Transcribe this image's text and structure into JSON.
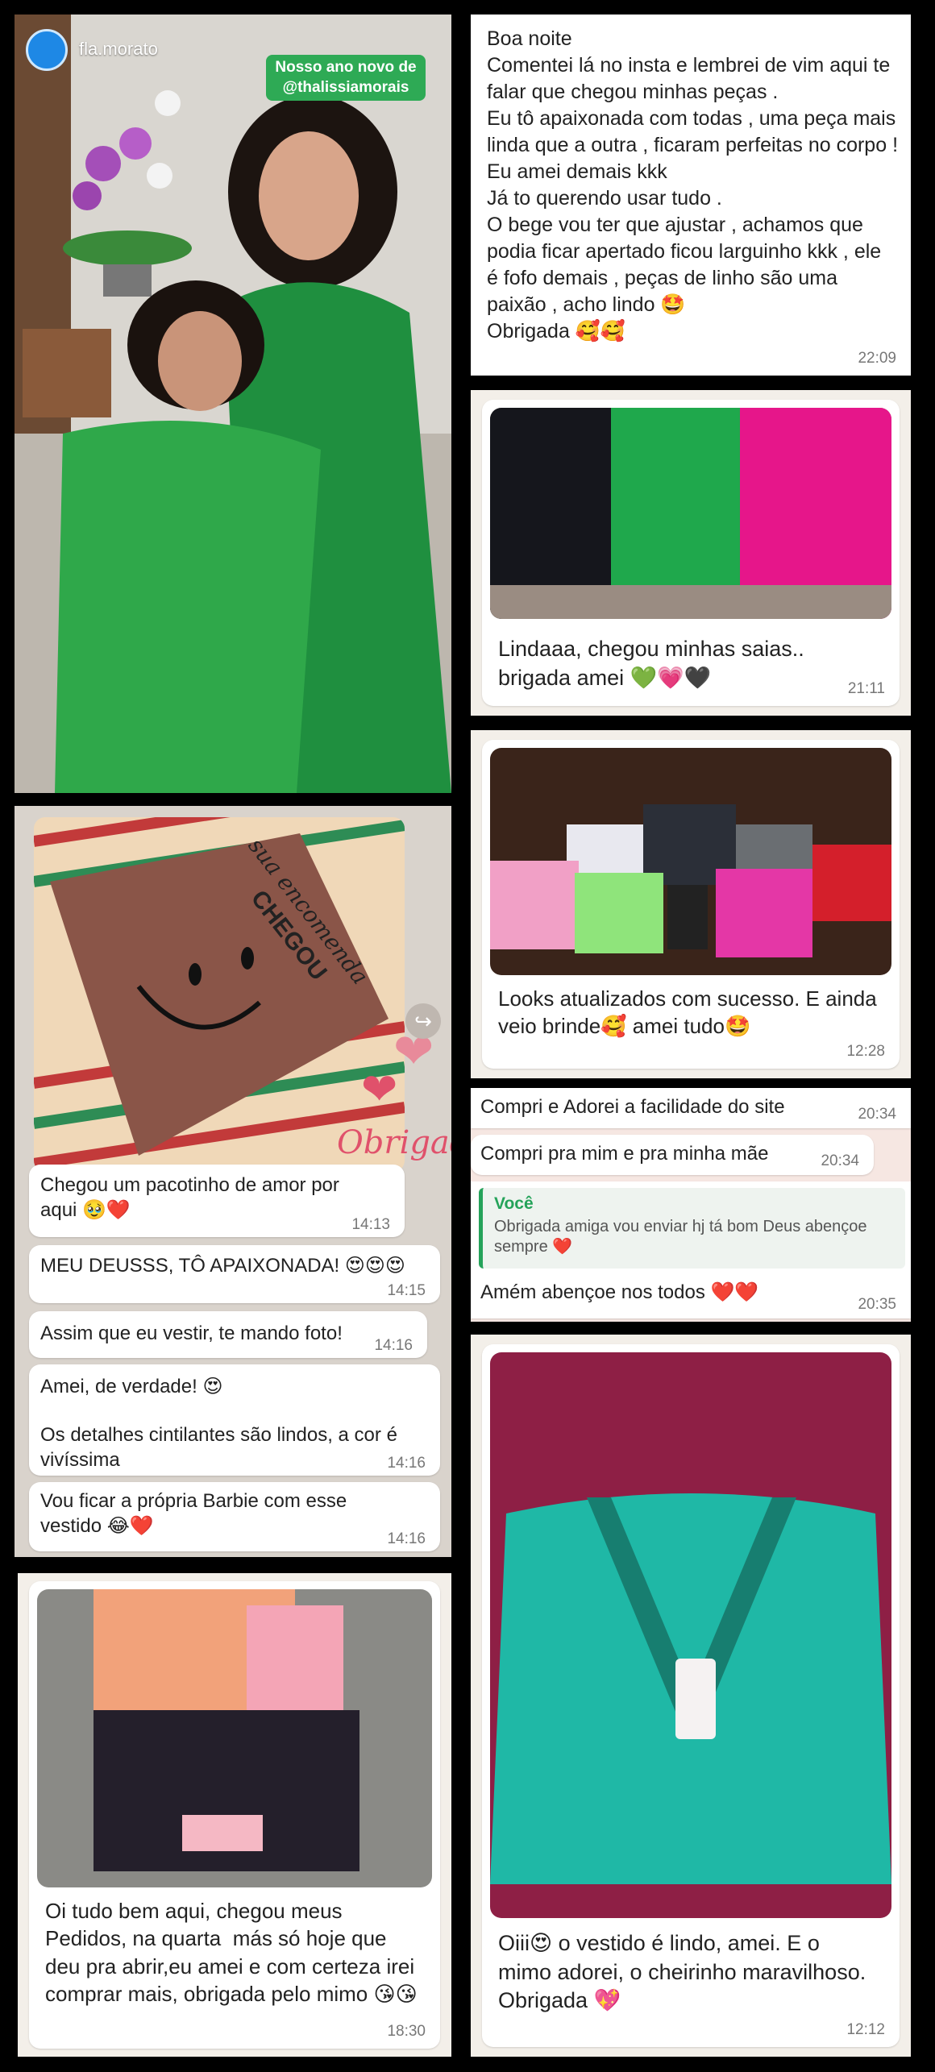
{
  "story": {
    "username": "fla.morato",
    "tag_line1": "Nosso ano novo de",
    "tag_line2": "@thalissiamorais"
  },
  "chat1": {
    "text": "Boa noite\nComentei lá no insta e lembrei de vim aqui te falar que chegou minhas peças .\nEu tô apaixonada com todas , uma peça mais linda que a outra , ficaram perfeitas no corpo !\nEu amei demais kkk\nJá to querendo usar tudo .\nO bege vou ter que ajustar , achamos que podia ficar apertado ficou larguinho kkk , ele é fofo demais , peças de linho são uma paixão , acho lindo 🤩\nObrigada 🥰🥰",
    "time": "22:09"
  },
  "chat2": {
    "text": "Lindaaa, chegou minhas saias..\nbrigada amei 💚💗🖤",
    "time": "21:11"
  },
  "chat3": {
    "text": "Looks atualizados com sucesso. E ainda veio brinde🥰 amei tudo🤩",
    "time": "12:28"
  },
  "chat4": {
    "msg1": "Compri e Adorei a facilidade do site",
    "time1": "20:34",
    "msg2": "Compri pra mim e pra minha mãe",
    "time2": "20:34",
    "reply_author": "Você",
    "reply_text": "Obrigada amiga vou enviar hj tá bom Deus abençoe sempre ❤️",
    "msg3": "Amém abençoe nos todos ❤️❤️",
    "time3": "20:35"
  },
  "chat5": {
    "package_text1": "sua encomenda",
    "package_text2": "CHEGOU",
    "sticker": "Obrigad",
    "msg1": "Chegou um pacotinho de amor por aqui 🥹❤️",
    "time1": "14:13",
    "msg2": "MEU DEUSSS, TÔ APAIXONADA! 😍😍😍",
    "time2": "14:15",
    "msg3": "Assim que eu vestir, te mando foto!",
    "time3": "14:16",
    "msg4a": "Amei, de verdade! 😍",
    "msg4b": "Os detalhes cintilantes são lindos, a cor é vivíssima",
    "time4": "14:16",
    "msg5": "Vou ficar a própria Barbie com esse vestido 😂❤️",
    "time5": "14:16"
  },
  "chat6": {
    "text": "Oi tudo bem aqui, chegou meus Pedidos, na quarta  más só hoje que deu pra abrir,eu amei e com certeza irei comprar mais, obrigada pelo mimo 😘😘",
    "time": "18:30"
  },
  "chat7": {
    "text": "Oiii😍 o vestido é lindo, amei. E o mimo adorei, o cheirinho maravilhoso. Obrigada 💖",
    "time": "12:12"
  },
  "colors": {
    "story_tag_bg": "#2eaa55",
    "green_dress": "#2fa84a",
    "teal_dress": "#1fb8a6",
    "reply_accent": "#25a35a"
  }
}
